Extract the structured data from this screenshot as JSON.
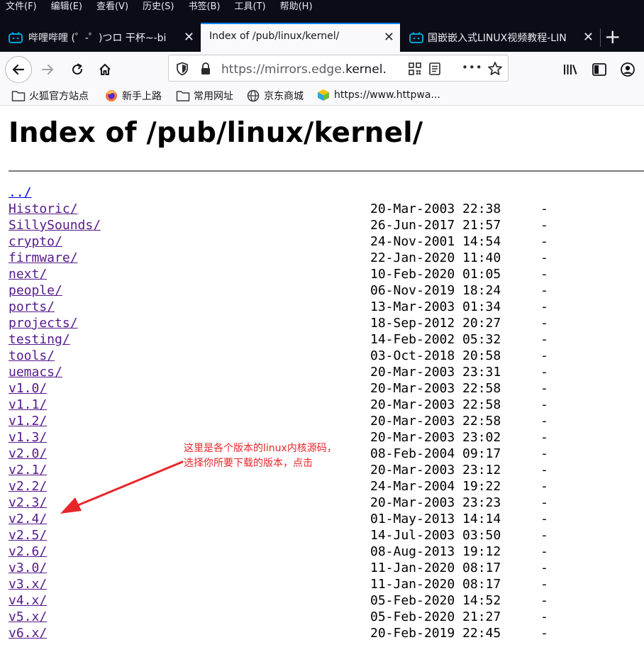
{
  "menubar": {
    "items": [
      "文件(F)",
      "编辑(E)",
      "查看(V)",
      "历史(S)",
      "书签(B)",
      "工具(T)",
      "帮助(H)"
    ]
  },
  "tabs": [
    {
      "title": "哔哩哔哩 (゜-゜)つロ 干杯~-bi",
      "active": false,
      "icon": "bilibili-icon"
    },
    {
      "title": "Index of /pub/linux/kernel/",
      "active": true,
      "icon": ""
    },
    {
      "title": "国嵌嵌入式LINUX视频教程-LIN",
      "active": false,
      "icon": "bilibili-icon"
    }
  ],
  "navbar": {
    "url_prefix": "https://mirrors.edge.",
    "url_domain": "kernel.",
    "tab_close_glyph": "✕",
    "newtab_glyph": "+",
    "more_glyph": "•••"
  },
  "bookmarks": [
    {
      "label": "火狐官方站点",
      "icon": "folder-icon"
    },
    {
      "label": "新手上路",
      "icon": "firefox-icon"
    },
    {
      "label": "常用网址",
      "icon": "folder-icon"
    },
    {
      "label": "京东商城",
      "icon": "globe-icon"
    },
    {
      "label": "https://www.httpwa...",
      "icon": "colorful-cube-icon"
    }
  ],
  "page": {
    "title": "Index of /pub/linux/kernel/",
    "entries": [
      {
        "name": "../",
        "date": "",
        "size": ""
      },
      {
        "name": "Historic/",
        "date": "20-Mar-2003 22:38",
        "size": "-"
      },
      {
        "name": "SillySounds/",
        "date": "26-Jun-2017 21:57",
        "size": "-"
      },
      {
        "name": "crypto/",
        "date": "24-Nov-2001 14:54",
        "size": "-"
      },
      {
        "name": "firmware/",
        "date": "22-Jan-2020 11:40",
        "size": "-"
      },
      {
        "name": "next/",
        "date": "10-Feb-2020 01:05",
        "size": "-"
      },
      {
        "name": "people/",
        "date": "06-Nov-2019 18:24",
        "size": "-"
      },
      {
        "name": "ports/",
        "date": "13-Mar-2003 01:34",
        "size": "-"
      },
      {
        "name": "projects/",
        "date": "18-Sep-2012 20:27",
        "size": "-"
      },
      {
        "name": "testing/",
        "date": "14-Feb-2002 05:32",
        "size": "-"
      },
      {
        "name": "tools/",
        "date": "03-Oct-2018 20:58",
        "size": "-"
      },
      {
        "name": "uemacs/",
        "date": "20-Mar-2003 23:31",
        "size": "-"
      },
      {
        "name": "v1.0/",
        "date": "20-Mar-2003 22:58",
        "size": "-"
      },
      {
        "name": "v1.1/",
        "date": "20-Mar-2003 22:58",
        "size": "-"
      },
      {
        "name": "v1.2/",
        "date": "20-Mar-2003 22:58",
        "size": "-"
      },
      {
        "name": "v1.3/",
        "date": "20-Mar-2003 23:02",
        "size": "-"
      },
      {
        "name": "v2.0/",
        "date": "08-Feb-2004 09:17",
        "size": "-"
      },
      {
        "name": "v2.1/",
        "date": "20-Mar-2003 23:12",
        "size": "-"
      },
      {
        "name": "v2.2/",
        "date": "24-Mar-2004 19:22",
        "size": "-"
      },
      {
        "name": "v2.3/",
        "date": "20-Mar-2003 23:23",
        "size": "-"
      },
      {
        "name": "v2.4/",
        "date": "01-May-2013 14:14",
        "size": "-"
      },
      {
        "name": "v2.5/",
        "date": "14-Jul-2003 03:50",
        "size": "-"
      },
      {
        "name": "v2.6/",
        "date": "08-Aug-2013 19:12",
        "size": "-"
      },
      {
        "name": "v3.0/",
        "date": "11-Jan-2020 08:17",
        "size": "-"
      },
      {
        "name": "v3.x/",
        "date": "11-Jan-2020 08:17",
        "size": "-"
      },
      {
        "name": "v4.x/",
        "date": "05-Feb-2020 14:52",
        "size": "-"
      },
      {
        "name": "v5.x/",
        "date": "05-Feb-2020 21:27",
        "size": "-"
      },
      {
        "name": "v6.x/",
        "date": "20-Feb-2019 22:45",
        "size": "-"
      }
    ]
  },
  "annotation": {
    "text": "这里是各个版本的linux内核源码，\n选择你所要下载的版本，点击",
    "color": "#e8262a"
  },
  "colors": {
    "chrome_dark": "#0c0c17",
    "toolbar": "#f9f9fb",
    "accent": "#0a84ff",
    "visited_link": "#551a8b",
    "link": "#0000ee"
  }
}
